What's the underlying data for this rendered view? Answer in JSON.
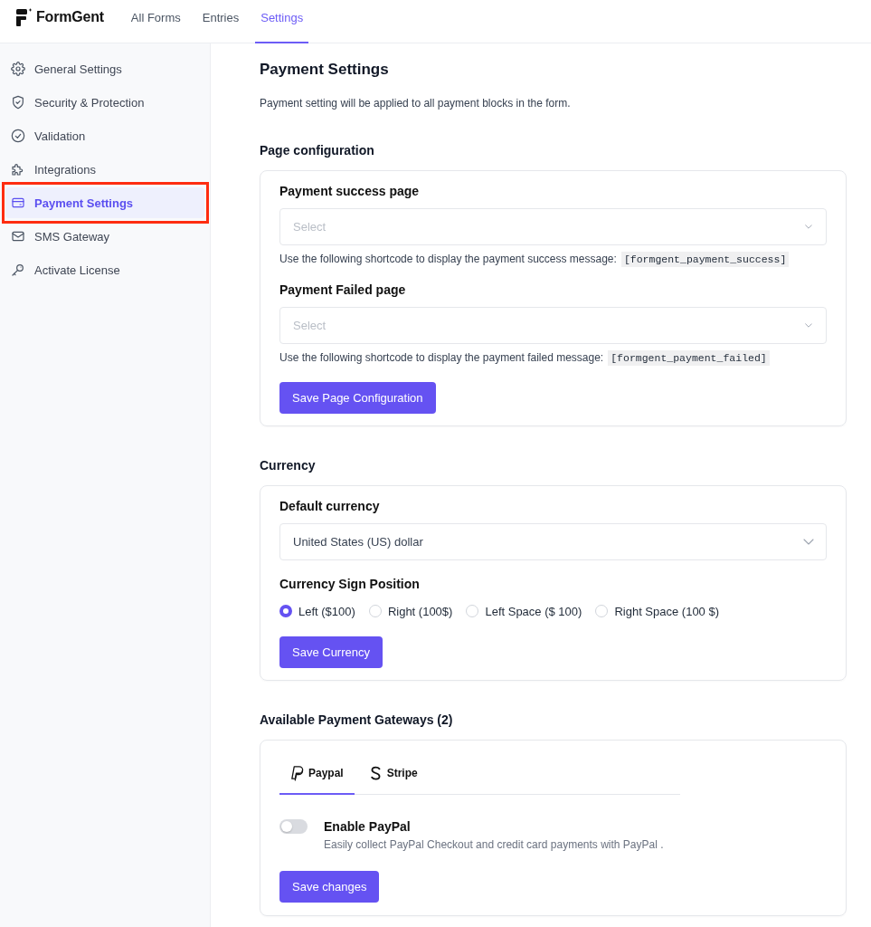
{
  "header": {
    "logo": "FormGent",
    "nav": [
      {
        "label": "All Forms",
        "selected": false
      },
      {
        "label": "Entries",
        "selected": false
      },
      {
        "label": "Settings",
        "selected": true
      }
    ]
  },
  "sidebar": {
    "items": [
      {
        "label": "General Settings",
        "selected": false,
        "highlighted": false
      },
      {
        "label": "Security & Protection",
        "selected": false,
        "highlighted": false
      },
      {
        "label": "Validation",
        "selected": false,
        "highlighted": false
      },
      {
        "label": "Integrations",
        "selected": false,
        "highlighted": false
      },
      {
        "label": "Payment Settings",
        "selected": true,
        "highlighted": true
      },
      {
        "label": "SMS Gateway",
        "selected": false,
        "highlighted": false
      },
      {
        "label": "Activate License",
        "selected": false,
        "highlighted": false
      }
    ]
  },
  "main": {
    "title": "Payment Settings",
    "description": "Payment setting will be applied to all payment blocks in the form."
  },
  "page_configuration": {
    "heading": "Page configuration",
    "fields": [
      {
        "label": "Payment success page",
        "placeholder": "Select",
        "hint": "Use the following shortcode to display the payment success message:",
        "shortcode": "[formgent_payment_success]"
      },
      {
        "label": "Payment Failed page",
        "placeholder": "Select",
        "hint": "Use the following shortcode to display the payment failed message:",
        "shortcode": "[formgent_payment_failed]"
      }
    ],
    "button": "Save Page Configuration"
  },
  "currency": {
    "heading": "Currency",
    "default_label": "Default currency",
    "default_value": "United States (US) dollar",
    "sign_label": "Currency Sign Position",
    "options": [
      {
        "label": "Left ($100)",
        "selected": true
      },
      {
        "label": "Right (100$)",
        "selected": false
      },
      {
        "label": "Left Space ($ 100)",
        "selected": false
      },
      {
        "label": "Right Space (100 $)",
        "selected": false
      }
    ],
    "button": "Save Currency"
  },
  "gateways": {
    "heading": "Available Payment Gateways (2)",
    "tabs": [
      {
        "label": "Paypal",
        "selected": true
      },
      {
        "label": "Stripe",
        "selected": false
      }
    ],
    "toggle": {
      "label": "Enable PayPal",
      "description": "Easily collect PayPal Checkout and credit card payments with PayPal .",
      "on": false
    },
    "button": "Save changes"
  }
}
